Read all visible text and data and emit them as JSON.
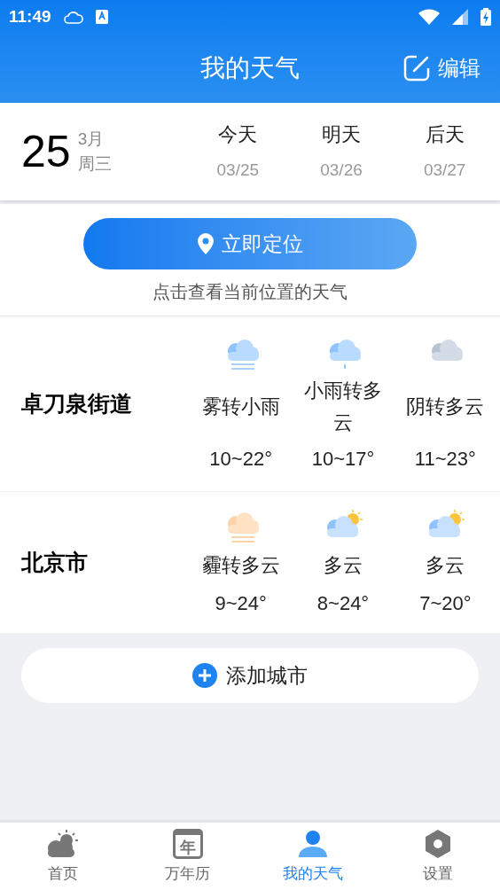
{
  "status_bar": {
    "time": "11:49"
  },
  "header": {
    "title": "我的天气",
    "edit": "编辑"
  },
  "date": {
    "day": "25",
    "month": "3月",
    "weekday": "周三",
    "days": [
      {
        "label": "今天",
        "date": "03/25"
      },
      {
        "label": "明天",
        "date": "03/26"
      },
      {
        "label": "后天",
        "date": "03/27"
      }
    ]
  },
  "locate": {
    "button": "立即定位",
    "hint": "点击查看当前位置的天气"
  },
  "cities": [
    {
      "name": "卓刀泉街道",
      "forecast": [
        {
          "kind": "fog",
          "text": "雾转小雨",
          "temp": "10~22°"
        },
        {
          "kind": "rain",
          "text": "小雨转多云",
          "temp": "10~17°"
        },
        {
          "kind": "overcast",
          "text": "阴转多云",
          "temp": "11~23°"
        }
      ]
    },
    {
      "name": "北京市",
      "forecast": [
        {
          "kind": "haze",
          "text": "霾转多云",
          "temp": "9~24°"
        },
        {
          "kind": "partly_cloudy",
          "text": "多云",
          "temp": "8~24°"
        },
        {
          "kind": "partly_cloudy",
          "text": "多云",
          "temp": "7~20°"
        }
      ]
    }
  ],
  "add_city": "添加城市",
  "nav": [
    {
      "kind": "home",
      "label": "首页",
      "selected": false
    },
    {
      "kind": "calendar",
      "label": "万年历",
      "icon_text": "年",
      "selected": false
    },
    {
      "kind": "person",
      "label": "我的天气",
      "selected": true
    },
    {
      "kind": "settings",
      "label": "设置",
      "selected": false
    }
  ]
}
